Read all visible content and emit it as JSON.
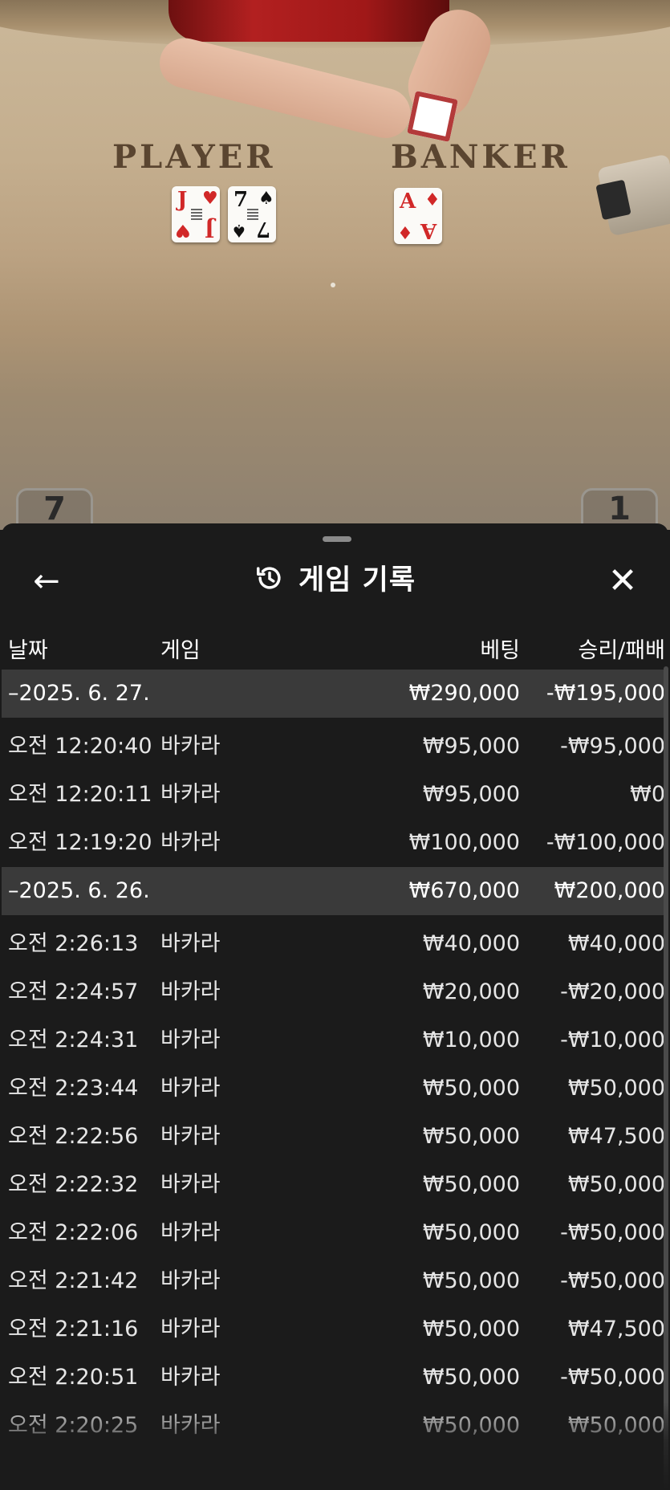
{
  "table": {
    "player_label": "PLAYER",
    "banker_label": "BANKER",
    "player_cards": [
      {
        "rank": "J",
        "suit": "♥",
        "color": "#d12828"
      },
      {
        "rank": "7",
        "suit": "♠",
        "color": "#111111"
      }
    ],
    "banker_cards": [
      {
        "rank": "A",
        "suit": "♦",
        "color": "#d12828"
      }
    ],
    "left_box": "7",
    "right_box": "1"
  },
  "panel": {
    "title": "게임 기록",
    "back_icon": "←",
    "close_icon": "✕",
    "columns": {
      "date": "날짜",
      "game": "게임",
      "bet": "베팅",
      "result": "승리/패배"
    },
    "groups": [
      {
        "date": "–2025. 6. 27.",
        "bet": "₩290,000",
        "result": "-₩195,000",
        "rows": [
          {
            "time": "오전 12:20:40",
            "game": "바카라",
            "bet": "₩95,000",
            "result": "-₩95,000"
          },
          {
            "time": "오전 12:20:11",
            "game": "바카라",
            "bet": "₩95,000",
            "result": "₩0"
          },
          {
            "time": "오전 12:19:20",
            "game": "바카라",
            "bet": "₩100,000",
            "result": "-₩100,000"
          }
        ]
      },
      {
        "date": "–2025. 6. 26.",
        "bet": "₩670,000",
        "result": "₩200,000",
        "rows": [
          {
            "time": "오전 2:26:13",
            "game": "바카라",
            "bet": "₩40,000",
            "result": "₩40,000"
          },
          {
            "time": "오전 2:24:57",
            "game": "바카라",
            "bet": "₩20,000",
            "result": "-₩20,000"
          },
          {
            "time": "오전 2:24:31",
            "game": "바카라",
            "bet": "₩10,000",
            "result": "-₩10,000"
          },
          {
            "time": "오전 2:23:44",
            "game": "바카라",
            "bet": "₩50,000",
            "result": "₩50,000"
          },
          {
            "time": "오전 2:22:56",
            "game": "바카라",
            "bet": "₩50,000",
            "result": "₩47,500"
          },
          {
            "time": "오전 2:22:32",
            "game": "바카라",
            "bet": "₩50,000",
            "result": "₩50,000"
          },
          {
            "time": "오전 2:22:06",
            "game": "바카라",
            "bet": "₩50,000",
            "result": "-₩50,000"
          },
          {
            "time": "오전 2:21:42",
            "game": "바카라",
            "bet": "₩50,000",
            "result": "-₩50,000"
          },
          {
            "time": "오전 2:21:16",
            "game": "바카라",
            "bet": "₩50,000",
            "result": "₩47,500"
          },
          {
            "time": "오전 2:20:51",
            "game": "바카라",
            "bet": "₩50,000",
            "result": "-₩50,000"
          },
          {
            "time": "오전 2:20:25",
            "game": "바카라",
            "bet": "₩50,000",
            "result": "₩50,000"
          }
        ]
      }
    ]
  }
}
